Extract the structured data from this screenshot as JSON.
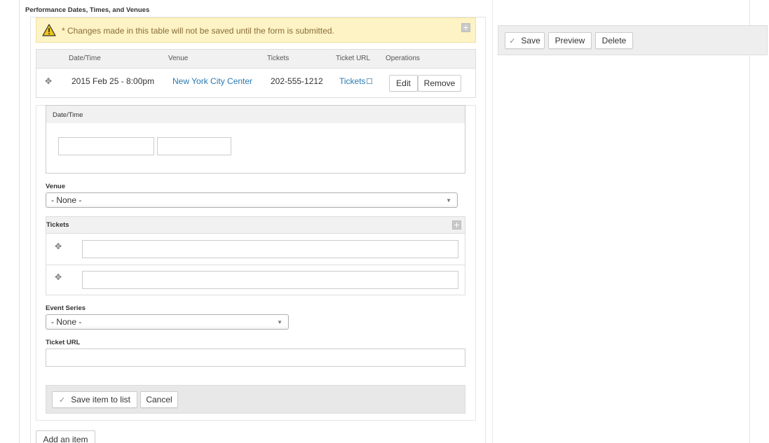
{
  "section": {
    "title": "Performance Dates, Times, and Venues"
  },
  "warning": {
    "text": "* Changes made in this table will not be saved until the form is submitted."
  },
  "table": {
    "headers": [
      "Date/Time",
      "Venue",
      "Tickets",
      "Ticket URL",
      "Operations"
    ],
    "rows": [
      {
        "datetime": "2015 Feb 25 - 8:00pm",
        "venue": "New York City Center",
        "tickets": "202-555-1212",
        "ticket_url": "Tickets",
        "edit_label": "Edit",
        "remove_label": "Remove"
      }
    ]
  },
  "form": {
    "datetime_label": "Date/Time",
    "date_value": "",
    "time_value": "",
    "venue_label": "Venue",
    "venue_selected": "- None -",
    "tickets_label": "Tickets",
    "ticket_inputs": [
      "",
      ""
    ],
    "event_series_label": "Event Series",
    "event_series_selected": "- None -",
    "ticket_url_label": "Ticket URL",
    "ticket_url_value": "",
    "save_item_label": "Save item to list",
    "cancel_label": "Cancel"
  },
  "add_item_label": "Add an item",
  "sidebar": {
    "save_label": "Save",
    "preview_label": "Preview",
    "delete_label": "Delete"
  },
  "colors": {
    "link": "#2a7ab0",
    "warning_bg": "#fdf3c4",
    "warning_text": "#8a6d3b"
  }
}
